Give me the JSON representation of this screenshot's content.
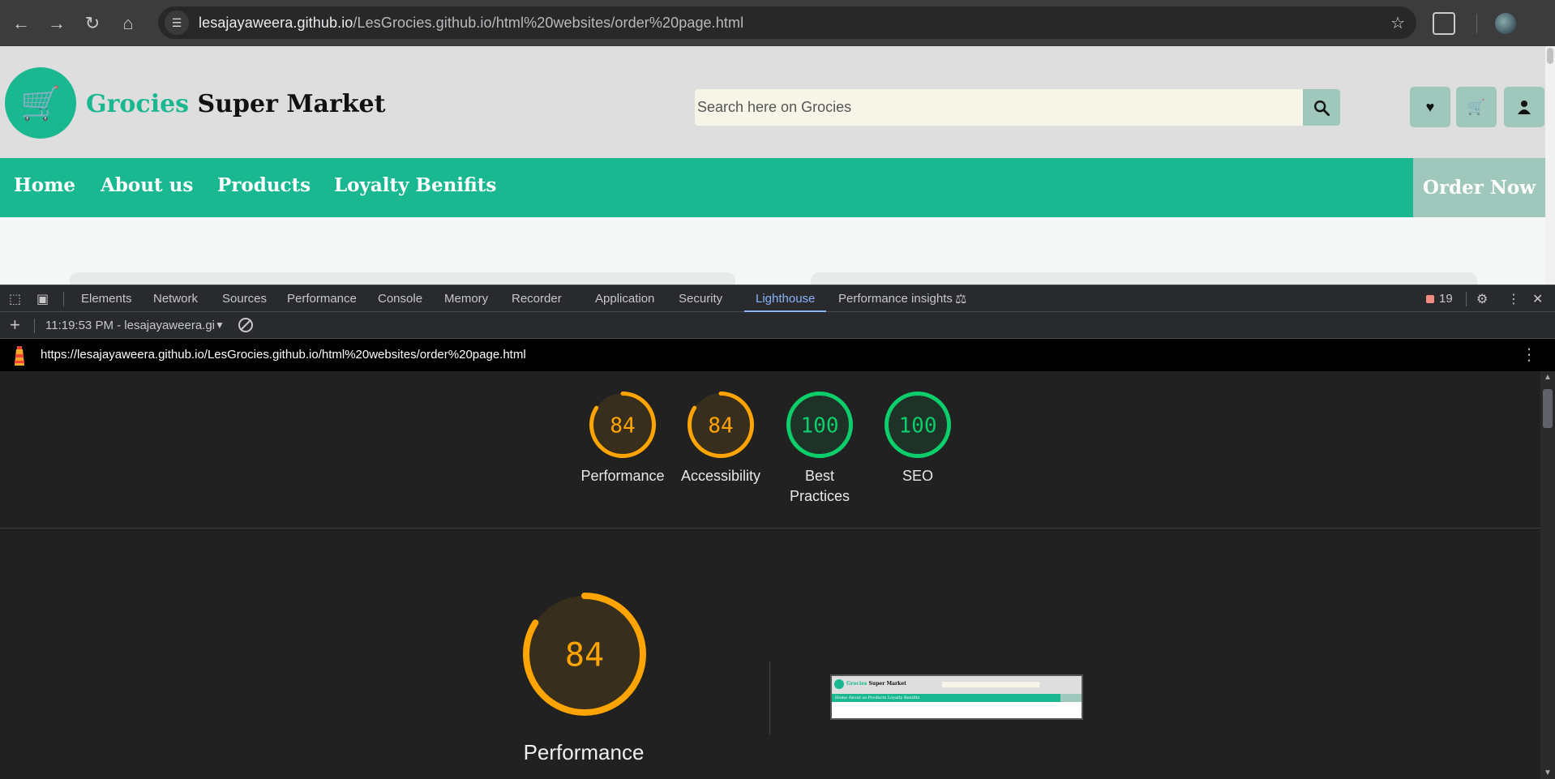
{
  "browser": {
    "url_host": "lesajayaweera.github.io",
    "url_path": "/LesGrocies.github.io/html%20websites/order%20page.html"
  },
  "site": {
    "brand_accent": "Grocies",
    "brand_rest": " Super Market",
    "search_placeholder": "Search here on Grocies",
    "nav": [
      "Home",
      "About us",
      "Products",
      "Loyalty Benifits"
    ],
    "order_now": "Order Now",
    "colors": {
      "primary": "#1ab891",
      "secondary": "#9fc7bb",
      "header_bg": "#dedede"
    }
  },
  "devtools": {
    "tabs": [
      "Elements",
      "Network",
      "Sources",
      "Performance",
      "Console",
      "Memory",
      "Recorder",
      "Application",
      "Security",
      "Lighthouse",
      "Performance insights"
    ],
    "active_tab": "Lighthouse",
    "issues_count": "19",
    "report_label": "11:19:53 PM - lesajayaweera.gi",
    "report_url": "https://lesajayaweera.github.io/LesGrocies.github.io/html%20websites/order%20page.html"
  },
  "lighthouse": {
    "scores": [
      {
        "label": "Performance",
        "score": 84,
        "color": "#ffa400"
      },
      {
        "label": "Accessibility",
        "score": 84,
        "color": "#ffa400"
      },
      {
        "label": "Best Practices",
        "score": 100,
        "color": "#0cce6b"
      },
      {
        "label": "SEO",
        "score": 100,
        "color": "#0cce6b"
      }
    ],
    "main": {
      "label": "Performance",
      "score": 84,
      "color": "#ffa400"
    }
  },
  "thumbnail": {
    "brand_accent": "Grocies",
    "brand_rest": " Super Market",
    "nav_text": "Home   About us   Products   Loyalty Benifits"
  }
}
